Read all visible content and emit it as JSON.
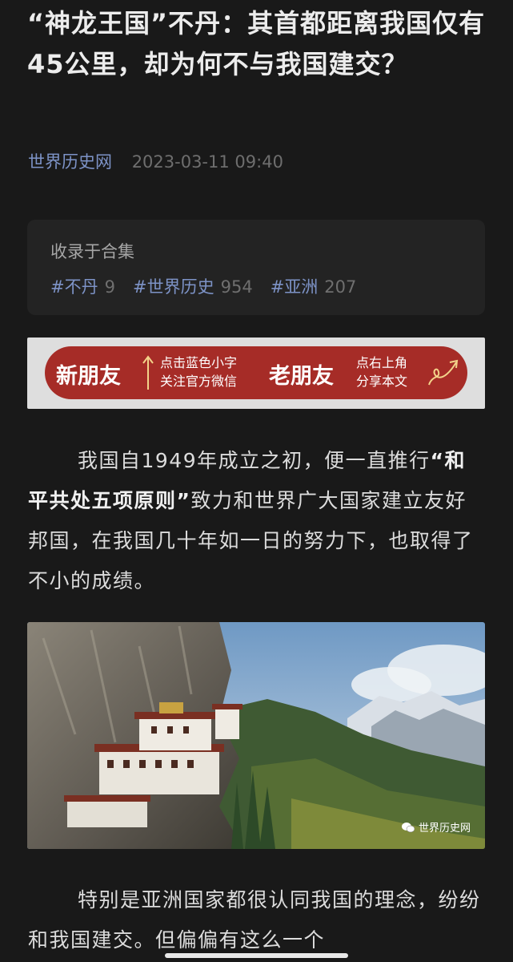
{
  "article": {
    "title": "“神龙王国”不丹：其首都距离我国仅有45公里，却为何不与我国建交？",
    "account": "世界历史网",
    "date": "2023-03-11 09:40"
  },
  "collection": {
    "label": "收录于合集",
    "tags": [
      {
        "name": "#不丹",
        "count": "9"
      },
      {
        "name": "#世界历史",
        "count": "954"
      },
      {
        "name": "#亚洲",
        "count": "207"
      }
    ]
  },
  "banner": {
    "new_friend": "新朋友",
    "new_line1": "点击蓝色小字",
    "new_line2": "关注官方微信",
    "old_friend": "老朋友",
    "old_line1": "点右上角",
    "old_line2": "分享本文"
  },
  "body": {
    "p1_before": "我国自1949年成立之初，便一直推行",
    "p1_bold": "“和平共处五项原则”",
    "p1_after": "致力和世界广大国家建立友好邦国，在我国几十年如一日的努力下，也取得了不小的成绩。",
    "p2": "特别是亚洲国家都很认同我国的理念，纷纷和我国建交。但偏偏有这么一个"
  },
  "image": {
    "watermark": "世界历史网",
    "watermark_icon": "wechat-icon"
  },
  "colors": {
    "background": "#191919",
    "link": "#7d93c7",
    "banner_red": "#a62c27"
  }
}
